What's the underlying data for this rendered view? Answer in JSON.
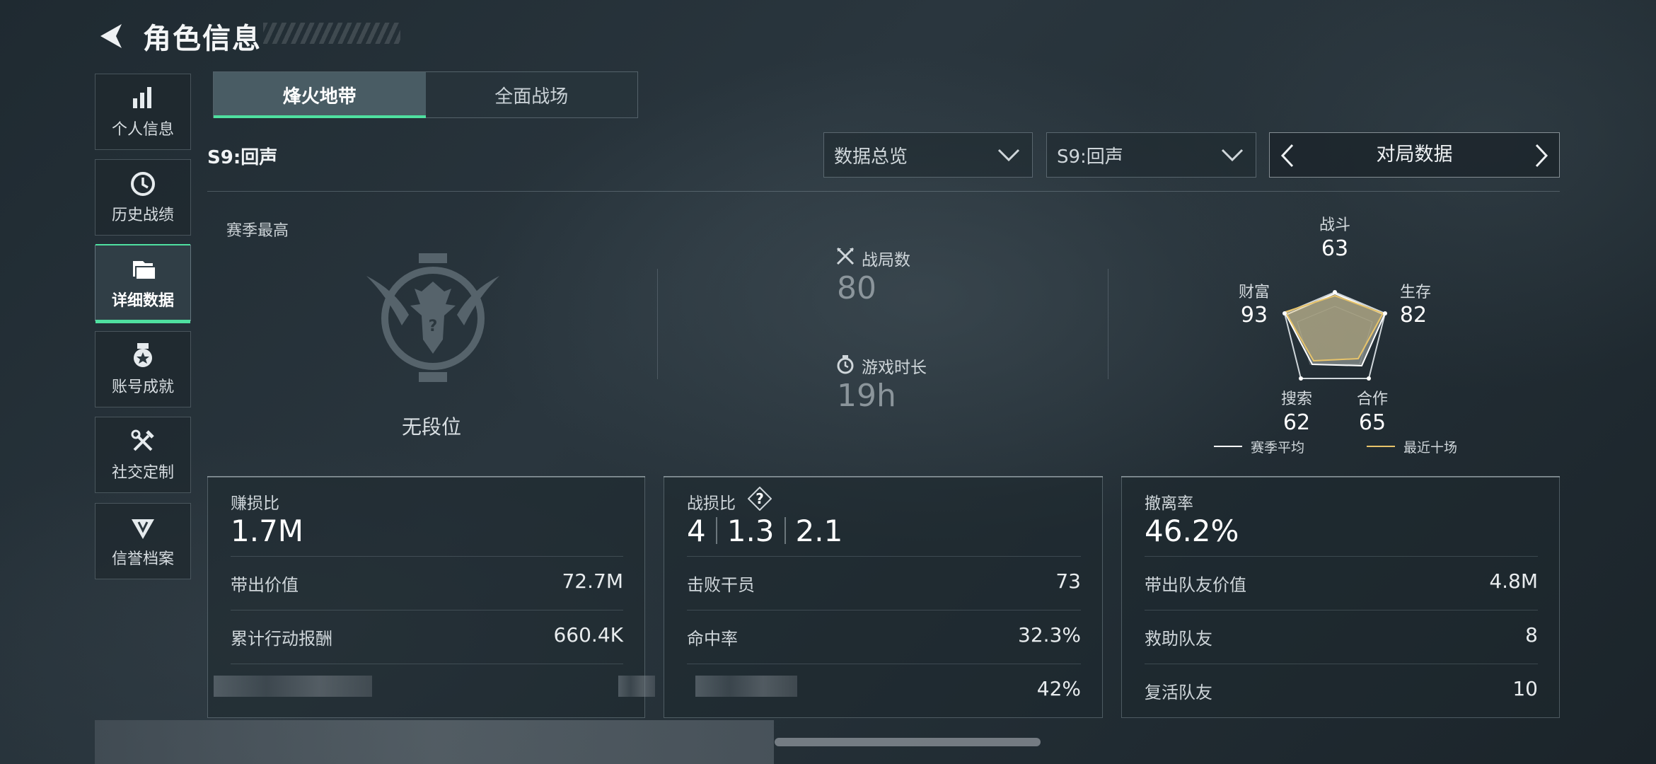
{
  "header": {
    "title": "角色信息"
  },
  "sidebar": {
    "items": [
      {
        "label": "个人信息",
        "icon": "bar-chart-icon"
      },
      {
        "label": "历史战绩",
        "icon": "history-clock-icon"
      },
      {
        "label": "详细数据",
        "icon": "folder-icon",
        "active": true
      },
      {
        "label": "账号成就",
        "icon": "medal-icon"
      },
      {
        "label": "社交定制",
        "icon": "tools-icon"
      },
      {
        "label": "信誉档案",
        "icon": "shield-wing-icon"
      }
    ]
  },
  "tabs": [
    {
      "label": "烽火地带",
      "active": true
    },
    {
      "label": "全面战场",
      "active": false
    }
  ],
  "season_label": "S9:回声",
  "filters": {
    "dropdown1": "数据总览",
    "dropdown2": "S9:回声",
    "pager_title": "对局数据"
  },
  "rank": {
    "section_label": "赛季最高",
    "name": "无段位"
  },
  "stats": {
    "matches_label": "战局数",
    "matches_value": "80",
    "playtime_label": "游戏时长",
    "playtime_value": "19h"
  },
  "radar": {
    "axes": [
      {
        "label": "战斗",
        "value": "63"
      },
      {
        "label": "生存",
        "value": "82"
      },
      {
        "label": "合作",
        "value": "65"
      },
      {
        "label": "搜索",
        "value": "62"
      },
      {
        "label": "财富",
        "value": "93"
      }
    ],
    "legend": [
      {
        "label": "赛季平均",
        "color": "#ffffff"
      },
      {
        "label": "最近十场",
        "color": "#e8c46a"
      }
    ]
  },
  "cards": [
    {
      "title": "赚损比",
      "big": "1.7M",
      "rows": [
        {
          "k": "带出价值",
          "v": "72.7M"
        },
        {
          "k": "累计行动报酬",
          "v": "660.4K"
        },
        {
          "k": "",
          "v": ""
        }
      ]
    },
    {
      "title": "战损比",
      "big_parts": [
        "4",
        "1.3",
        "2.1"
      ],
      "rows": [
        {
          "k": "击败干员",
          "v": "73"
        },
        {
          "k": "命中率",
          "v": "32.3%"
        },
        {
          "k": "",
          "v": "42%"
        }
      ]
    },
    {
      "title": "撤离率",
      "big": "46.2%",
      "rows": [
        {
          "k": "带出队友价值",
          "v": "4.8M"
        },
        {
          "k": "救助队友",
          "v": "8"
        },
        {
          "k": "复活队友",
          "v": "10"
        }
      ]
    }
  ]
}
